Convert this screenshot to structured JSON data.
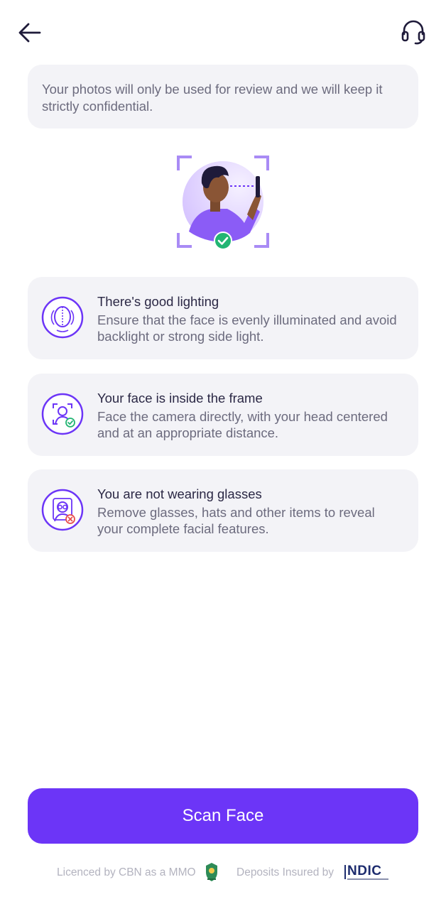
{
  "header": {
    "back_icon": "arrow-left-icon",
    "support_icon": "headset-icon"
  },
  "notice": {
    "text": "Your photos will only be used for review and we will keep it strictly confidential."
  },
  "hero": {
    "illustration": "face-scan-illustration",
    "check_icon": "check-circle-icon"
  },
  "tips": [
    {
      "icon": "face-lighting-icon",
      "title": "There's good lighting",
      "description": "Ensure that the face is evenly illuminated and avoid backlight or strong side light."
    },
    {
      "icon": "face-frame-icon",
      "title": "Your face is inside the frame",
      "description": "Face the camera directly, with your head centered and at an appropriate distance."
    },
    {
      "icon": "no-glasses-icon",
      "title": "You are not wearing glasses",
      "description": "Remove glasses, hats and other items to reveal your complete facial features."
    }
  ],
  "actions": {
    "scan_label": "Scan Face"
  },
  "footer": {
    "licence_text": "Licenced by CBN as a MMO",
    "deposits_text": "Deposits Insured by",
    "ndic_label": "NDIC"
  },
  "colors": {
    "primary": "#6c35f7",
    "card_bg": "#f3f3f7",
    "success": "#22b573",
    "error": "#e84c4c"
  }
}
